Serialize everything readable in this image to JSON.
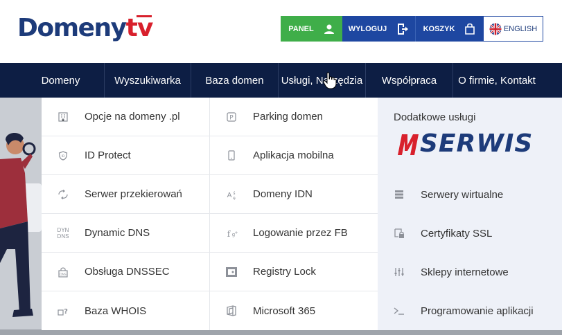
{
  "header": {
    "logo_text": "Domeny",
    "logo_tv": "tv",
    "buttons": {
      "panel": "PANEL",
      "wyloguj": "WYLOGUJ",
      "koszyk": "KOSZYK",
      "english": "ENGLISH"
    }
  },
  "nav": {
    "items": [
      {
        "label": "Domeny"
      },
      {
        "label": "Wyszukiwarka"
      },
      {
        "label": "Baza domen"
      },
      {
        "label": "Usługi, Narzędzia"
      },
      {
        "label": "Współpraca"
      },
      {
        "label": "O firmie, Kontakt"
      }
    ]
  },
  "dropdown": {
    "col1": [
      {
        "label": "Opcje na domeny .pl",
        "icon": "building-icon"
      },
      {
        "label": "ID Protect",
        "icon": "shield-icon"
      },
      {
        "label": "Serwer przekierowań",
        "icon": "redirect-icon"
      },
      {
        "label": "Dynamic DNS",
        "icon": "dyn-dns-icon",
        "icon_text_1": "DYN",
        "icon_text_2": "DNS"
      },
      {
        "label": "Obsługa DNSSEC",
        "icon": "dnssec-icon"
      },
      {
        "label": "Baza WHOIS",
        "icon": "whois-icon"
      }
    ],
    "col2": [
      {
        "label": "Parking domen",
        "icon": "parking-icon"
      },
      {
        "label": "Aplikacja mobilna",
        "icon": "mobile-icon"
      },
      {
        "label": "Domeny IDN",
        "icon": "idn-icon"
      },
      {
        "label": "Logowanie przez FB",
        "icon": "facebook-login-icon"
      },
      {
        "label": "Registry Lock",
        "icon": "lock-icon"
      },
      {
        "label": "Microsoft 365",
        "icon": "office-icon"
      }
    ],
    "col3": {
      "promo_title": "Dodatkowe usługi",
      "promo_brand": "SERWIS",
      "promo_brand_m": "M",
      "items": [
        {
          "label": "Serwery wirtualne",
          "icon": "server-icon"
        },
        {
          "label": "Certyfikaty SSL",
          "icon": "ssl-certificate-icon"
        },
        {
          "label": "Sklepy internetowe",
          "icon": "sliders-icon"
        },
        {
          "label": "Programowanie aplikacji",
          "icon": "terminal-icon"
        }
      ]
    }
  },
  "colors": {
    "brand_blue": "#1d3b7a",
    "brand_red": "#d8202c",
    "panel_green": "#3fae49",
    "button_blue": "#1e47a1",
    "nav_bg": "#0d1e44",
    "promo_bg": "#eef1f8"
  }
}
